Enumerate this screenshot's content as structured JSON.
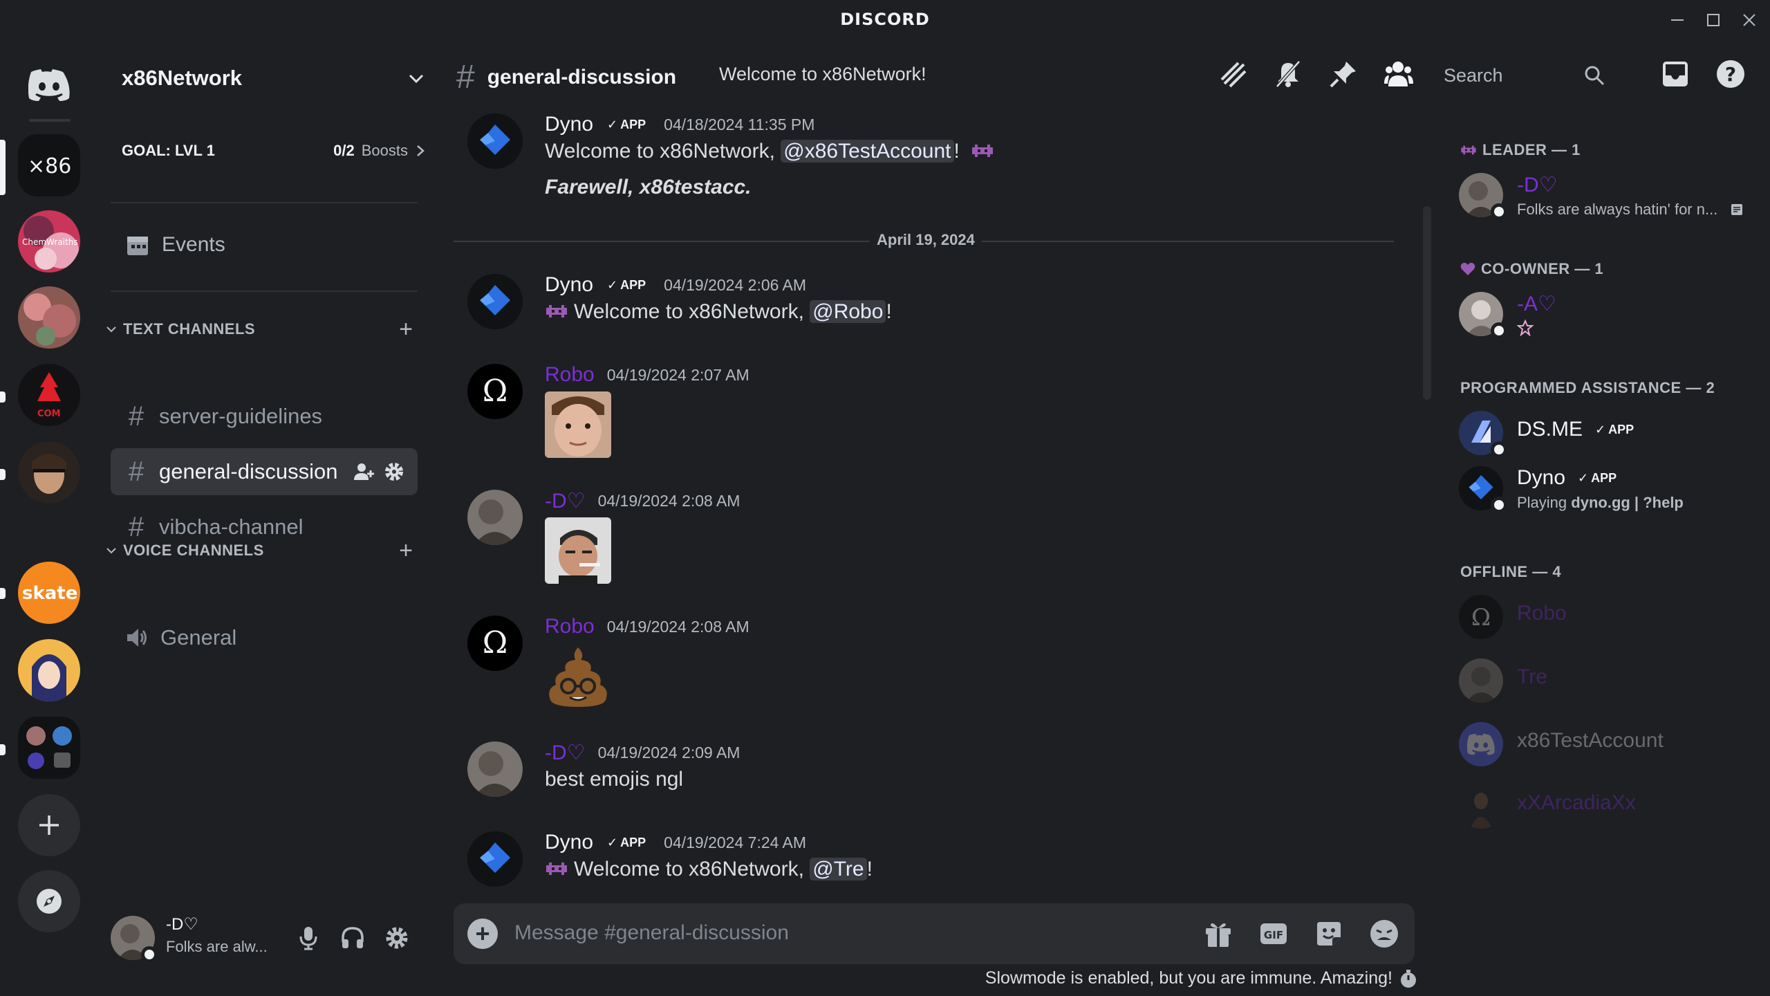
{
  "window": {
    "brand": "DISCORD"
  },
  "server": {
    "name": "x86Network",
    "goal_label": "GOAL: LVL 1",
    "boosts_count": "0/2",
    "boosts_label": "Boosts",
    "events_label": "Events"
  },
  "rail": {
    "servers": [
      {
        "name": "x86",
        "label": "x86"
      },
      {
        "name": "chemwraiths",
        "label": "ChemWraiths"
      }
    ]
  },
  "categories": {
    "text": "TEXT CHANNELS",
    "voice": "VOICE CHANNELS"
  },
  "channels": {
    "text": [
      {
        "name": "server-guidelines"
      },
      {
        "name": "general-discussion"
      },
      {
        "name": "vibcha-channel"
      }
    ],
    "voice": [
      {
        "name": "General"
      }
    ]
  },
  "user": {
    "name": "-D♡",
    "status": "Folks are alw..."
  },
  "header": {
    "channel": "general-discussion",
    "topic": "Welcome to x86Network!",
    "search_placeholder": "Search"
  },
  "messages": [
    {
      "author": "Dyno",
      "tag": "APP",
      "timestamp": "04/18/2024 11:35 PM",
      "line1_pre": "Welcome to x86Network, ",
      "line1_mention": "@x86TestAccount",
      "line1_post": "!",
      "line2": "Farewell, x86testacc."
    },
    {
      "author": "Dyno",
      "tag": "APP",
      "timestamp": "04/19/2024 2:06 AM",
      "pre": "Welcome to x86Network, ",
      "mention": "@Robo",
      "post": "!"
    },
    {
      "author": "Robo",
      "timestamp": "04/19/2024 2:07 AM"
    },
    {
      "author": "-D♡",
      "timestamp": "04/19/2024 2:08 AM"
    },
    {
      "author": "Robo",
      "timestamp": "04/19/2024 2:08 AM"
    },
    {
      "author": "-D♡",
      "timestamp": "04/19/2024 2:09 AM",
      "text": "best emojis ngl"
    },
    {
      "author": "Dyno",
      "tag": "APP",
      "timestamp": "04/19/2024 7:24 AM",
      "pre": "Welcome to x86Network, ",
      "mention": "@Tre",
      "post": "!"
    }
  ],
  "date_divider": "April 19, 2024",
  "composer": {
    "placeholder": "Message #general-discussion",
    "gif_label": "GIF",
    "slowmode": "Slowmode is enabled, but you are immune. Amazing!"
  },
  "members": {
    "leader_role": "LEADER — 1",
    "coowner_role": "CO-OWNER — 1",
    "assist_role": "PROGRAMMED ASSISTANCE — 2",
    "offline_role": "OFFLINE — 4",
    "leader": {
      "name": "-D♡",
      "status": "Folks are always hatin' for n..."
    },
    "coowner": {
      "name": "-A♡"
    },
    "bots": [
      {
        "name": "DS.ME",
        "tag": "APP"
      },
      {
        "name": "Dyno",
        "tag": "APP",
        "activity_pre": "Playing ",
        "activity_bold": "dyno.gg | ?help"
      }
    ],
    "offline": [
      {
        "name": "Robo"
      },
      {
        "name": "Tre"
      },
      {
        "name": "x86TestAccount"
      },
      {
        "name": "xXArcadiaXx"
      }
    ]
  },
  "colors": {
    "background": "#1e1f22",
    "accent_purple": "#7c2fd6",
    "dyno_blue": "#2b6fe0",
    "mention_bg": "#3a3c42"
  }
}
